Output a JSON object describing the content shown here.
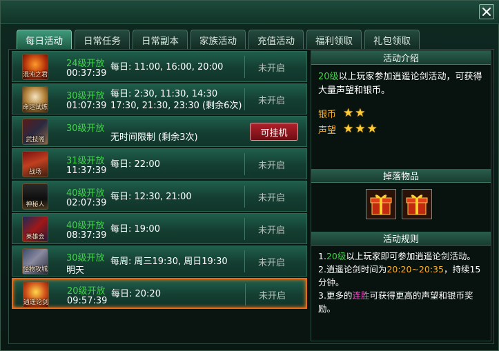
{
  "tabs": [
    {
      "label": "每日活动",
      "active": true
    },
    {
      "label": "日常任务"
    },
    {
      "label": "日常副本"
    },
    {
      "label": "家族活动"
    },
    {
      "label": "充值活动"
    },
    {
      "label": "福利领取"
    },
    {
      "label": "礼包领取"
    }
  ],
  "activities": [
    {
      "icon_label": "混沌之君",
      "icon": "chaos-lord-icon",
      "level": "24级开放",
      "countdown": "00:37:39",
      "schedule": [
        "每日: 11:00, 16:00, 20:00"
      ],
      "status": "未开启"
    },
    {
      "icon_label": "命运试炼",
      "icon": "fate-trial-icon",
      "level": "30级开放",
      "countdown": "01:07:39",
      "schedule": [
        "每日: 2:30, 11:30, 14:30",
        "17:30, 21:30, 23:30 (剩余6次)"
      ],
      "status": "未开启"
    },
    {
      "icon_label": "武技阁",
      "icon": "martial-pavilion-icon",
      "level": "30级开放",
      "countdown": "",
      "schedule": [
        "无时间限制 (剩余3次)"
      ],
      "status": "",
      "button": "可挂机"
    },
    {
      "icon_label": "战场",
      "icon": "battlefield-icon",
      "level": "31级开放",
      "countdown": "11:37:39",
      "schedule": [
        "每日: 22:00"
      ],
      "status": "未开启"
    },
    {
      "icon_label": "神秘人",
      "icon": "mystery-man-icon",
      "level": "40级开放",
      "countdown": "02:07:39",
      "schedule": [
        "每日: 12:30, 21:00"
      ],
      "status": "未开启"
    },
    {
      "icon_label": "英雄会",
      "icon": "hero-meeting-icon",
      "level": "40级开放",
      "countdown": "08:37:39",
      "schedule": [
        "每日: 19:00"
      ],
      "status": "未开启"
    },
    {
      "icon_label": "怪物攻城",
      "icon": "monster-siege-icon",
      "level": "30级开放",
      "countdown": "明天",
      "schedule": [
        "每周: 周三19:30, 周日19:30"
      ],
      "status": "未开启"
    },
    {
      "icon_label": "逍遥论剑",
      "icon": "sword-debate-icon",
      "level": "20级开放",
      "countdown": "09:57:39",
      "schedule": [
        "每日: 20:20"
      ],
      "status": "未开启",
      "selected": true
    }
  ],
  "panel": {
    "intro_title": "活动介绍",
    "intro_level": "20级",
    "intro_text": "以上玩家参加逍遥论剑活动，可获得大量声望和银币。",
    "rewards": [
      {
        "label": "银币",
        "stars": 2
      },
      {
        "label": "声望",
        "stars": 3
      }
    ],
    "drop_title": "掉落物品",
    "drops": [
      "gift-box-icon",
      "gift-box-icon"
    ],
    "rules_title": "活动规则",
    "rules": {
      "r1_prefix": "1.",
      "r1_level": "20级",
      "r1_text": "以上玩家即可参加逍遥论剑活动。",
      "r2_prefix": "2.逍遥论剑时间为",
      "r2_time": "20:20~20:35",
      "r2_text": "，持续15分钟。",
      "r3_prefix": "3.更多的",
      "r3_streak": "连胜",
      "r3_text": "可获得更高的声望和银币奖励。"
    }
  },
  "colors": {
    "accent_green": "#42d24a",
    "highlight_orange": "#e86a14",
    "gold": "#ffb22a",
    "pink": "#ff4fd0"
  }
}
